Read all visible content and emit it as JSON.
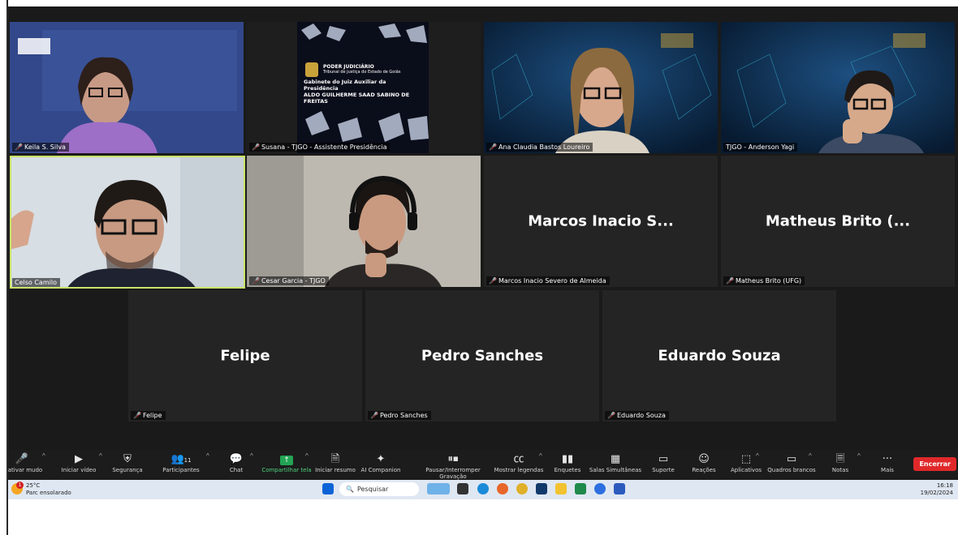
{
  "tiles": {
    "keila": {
      "name": "Keila S. Silva",
      "muted": true
    },
    "susana": {
      "name": "Susana - TJGO - Assistente Presidência",
      "muted": true,
      "slide": {
        "org": "PODER JUDICIÁRIO",
        "court": "Tribunal de Justiça do Estado de Goiás",
        "office": "Gabinete do Juiz Auxiliar da Presidência",
        "judge": "ALDO GUILHERME SAAD SABINO DE FREITAS"
      }
    },
    "ana": {
      "name": "Ana Claudia Bastos Loureiro",
      "muted": true
    },
    "anderson": {
      "name": "TJGO - Anderson Yagi",
      "muted": false
    },
    "celso": {
      "name": "Celso Camilo",
      "muted": false,
      "active": true
    },
    "cesar": {
      "name": "Cesar Garcia - TJGO",
      "muted": true
    },
    "marcos": {
      "display": "Marcos Inacio S...",
      "name": "Marcos Inacio Severo de Almeida",
      "muted": true
    },
    "matheus": {
      "display": "Matheus Brito (...",
      "name": "Matheus Brito (UFG)",
      "muted": true
    },
    "felipe": {
      "display": "Felipe",
      "name": "Felipe",
      "muted": true
    },
    "pedro": {
      "display": "Pedro Sanches",
      "name": "Pedro Sanches",
      "muted": true
    },
    "eduardo": {
      "display": "Eduardo Souza",
      "name": "Eduardo Souza",
      "muted": true
    }
  },
  "toolbar": {
    "unmute": "esativar mudo",
    "video": "Iniciar vídeo",
    "security": "Segurança",
    "participants": "Participantes",
    "participants_count": "11",
    "chat": "Chat",
    "share": "Compartilhar tela",
    "summary": "Iniciar resumo",
    "ai": "AI Companion",
    "record": "Pausar/Interromper Gravação",
    "captions": "Mostrar legendas",
    "polls": "Enquetes",
    "breakout": "Salas Simultâneas",
    "support": "Suporte",
    "reactions": "Reações",
    "apps": "Aplicativos",
    "whiteboards": "Quadros brancos",
    "notes": "Notas",
    "more": "Mais",
    "end": "Encerrar"
  },
  "taskbar": {
    "temp": "25°C",
    "weather": "Parc ensolarado",
    "weather_badge": "1",
    "search_placeholder": "Pesquisar",
    "time": "16:18",
    "date": "19/02/2024"
  },
  "colors": {
    "active_border": "#c8e36a",
    "share_green": "#23a455",
    "end_red": "#e0282a",
    "muted_red": "#e02828"
  }
}
